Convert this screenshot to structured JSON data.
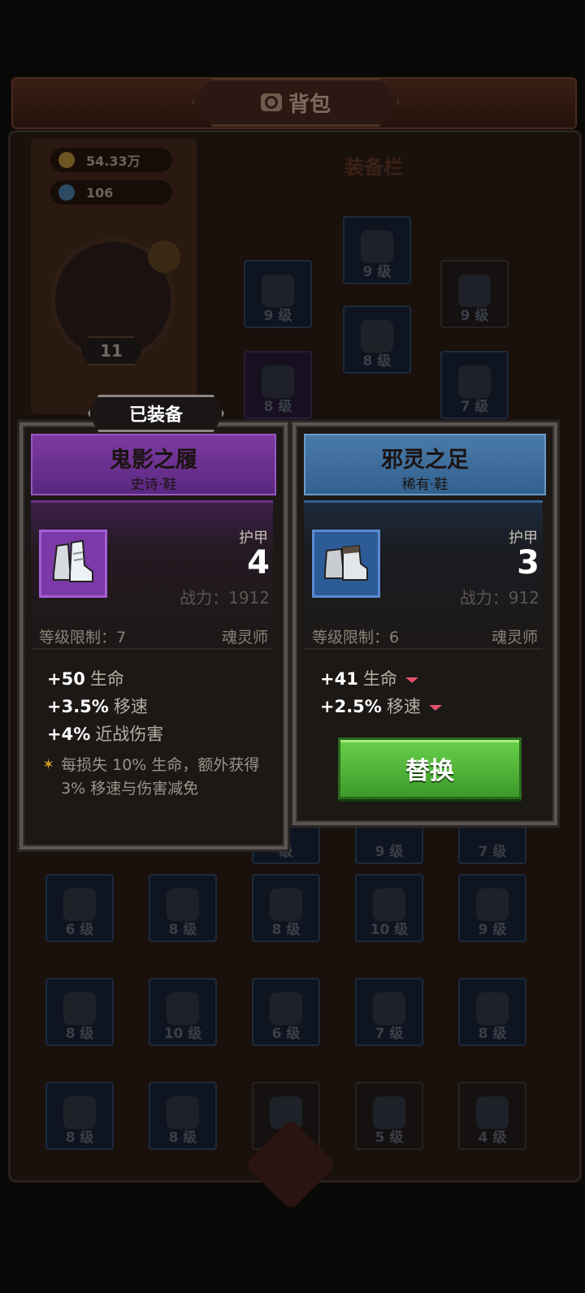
{
  "header": {
    "title": "背包"
  },
  "resources": {
    "gold": "54.33万",
    "gems": "106"
  },
  "player": {
    "level": "11"
  },
  "equipment_panel": {
    "title": "装备栏",
    "slots": [
      {
        "level": "9 级"
      },
      {
        "level": "9 级"
      },
      {
        "level": "9 级"
      },
      {
        "level": "8 级"
      },
      {
        "level": "8 级"
      },
      {
        "level": "7 级"
      }
    ]
  },
  "inventory": {
    "row0": [
      "级",
      "9 级",
      "7 级"
    ],
    "row1": [
      "6 级",
      "8 级",
      "8 级",
      "10 级",
      "9 级"
    ],
    "row2": [
      "8 级",
      "10 级",
      "6 级",
      "7 级",
      "8 级"
    ],
    "row3": [
      "8 级",
      "8 级",
      "",
      "5 级",
      "4 级"
    ]
  },
  "equipped_tag": "已装备",
  "equipped_item": {
    "name": "鬼影之履",
    "rarity_type": "史诗·鞋",
    "armor_label": "护甲",
    "armor_value": "4",
    "power": "战力：1912",
    "level_req": "等级限制：7",
    "class": "魂灵师",
    "attributes": [
      {
        "value": "+50",
        "name": "生命"
      },
      {
        "value": "+3.5%",
        "name": "移速"
      },
      {
        "value": "+4%",
        "name": "近战伤害"
      }
    ],
    "passive": "每损失 10% 生命，额外获得 3% 移速与伤害减免"
  },
  "compare_item": {
    "name": "邪灵之足",
    "rarity_type": "稀有·鞋",
    "armor_label": "护甲",
    "armor_value": "3",
    "power": "战力：912",
    "level_req": "等级限制：6",
    "class": "魂灵师",
    "attributes": [
      {
        "value": "+41",
        "name": "生命"
      },
      {
        "value": "+2.5%",
        "name": "移速"
      }
    ],
    "replace_label": "替换"
  },
  "colors": {
    "epic": "#7b3aa8",
    "rare": "#2c5b98",
    "button": "#4cb035",
    "decrease": "#e0506a"
  }
}
